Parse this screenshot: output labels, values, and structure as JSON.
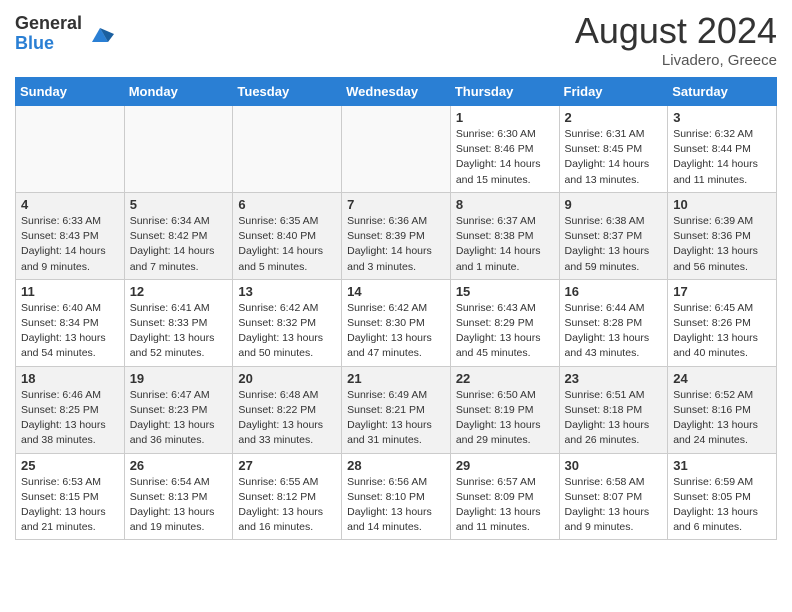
{
  "header": {
    "logo_general": "General",
    "logo_blue": "Blue",
    "month_year": "August 2024",
    "location": "Livadero, Greece"
  },
  "days_of_week": [
    "Sunday",
    "Monday",
    "Tuesday",
    "Wednesday",
    "Thursday",
    "Friday",
    "Saturday"
  ],
  "weeks": [
    [
      {
        "day": "",
        "sunrise": "",
        "sunset": "",
        "daylight": "",
        "empty": true
      },
      {
        "day": "",
        "sunrise": "",
        "sunset": "",
        "daylight": "",
        "empty": true
      },
      {
        "day": "",
        "sunrise": "",
        "sunset": "",
        "daylight": "",
        "empty": true
      },
      {
        "day": "",
        "sunrise": "",
        "sunset": "",
        "daylight": "",
        "empty": true
      },
      {
        "day": "1",
        "sunrise": "Sunrise: 6:30 AM",
        "sunset": "Sunset: 8:46 PM",
        "daylight": "Daylight: 14 hours and 15 minutes."
      },
      {
        "day": "2",
        "sunrise": "Sunrise: 6:31 AM",
        "sunset": "Sunset: 8:45 PM",
        "daylight": "Daylight: 14 hours and 13 minutes."
      },
      {
        "day": "3",
        "sunrise": "Sunrise: 6:32 AM",
        "sunset": "Sunset: 8:44 PM",
        "daylight": "Daylight: 14 hours and 11 minutes."
      }
    ],
    [
      {
        "day": "4",
        "sunrise": "Sunrise: 6:33 AM",
        "sunset": "Sunset: 8:43 PM",
        "daylight": "Daylight: 14 hours and 9 minutes."
      },
      {
        "day": "5",
        "sunrise": "Sunrise: 6:34 AM",
        "sunset": "Sunset: 8:42 PM",
        "daylight": "Daylight: 14 hours and 7 minutes."
      },
      {
        "day": "6",
        "sunrise": "Sunrise: 6:35 AM",
        "sunset": "Sunset: 8:40 PM",
        "daylight": "Daylight: 14 hours and 5 minutes."
      },
      {
        "day": "7",
        "sunrise": "Sunrise: 6:36 AM",
        "sunset": "Sunset: 8:39 PM",
        "daylight": "Daylight: 14 hours and 3 minutes."
      },
      {
        "day": "8",
        "sunrise": "Sunrise: 6:37 AM",
        "sunset": "Sunset: 8:38 PM",
        "daylight": "Daylight: 14 hours and 1 minute."
      },
      {
        "day": "9",
        "sunrise": "Sunrise: 6:38 AM",
        "sunset": "Sunset: 8:37 PM",
        "daylight": "Daylight: 13 hours and 59 minutes."
      },
      {
        "day": "10",
        "sunrise": "Sunrise: 6:39 AM",
        "sunset": "Sunset: 8:36 PM",
        "daylight": "Daylight: 13 hours and 56 minutes."
      }
    ],
    [
      {
        "day": "11",
        "sunrise": "Sunrise: 6:40 AM",
        "sunset": "Sunset: 8:34 PM",
        "daylight": "Daylight: 13 hours and 54 minutes."
      },
      {
        "day": "12",
        "sunrise": "Sunrise: 6:41 AM",
        "sunset": "Sunset: 8:33 PM",
        "daylight": "Daylight: 13 hours and 52 minutes."
      },
      {
        "day": "13",
        "sunrise": "Sunrise: 6:42 AM",
        "sunset": "Sunset: 8:32 PM",
        "daylight": "Daylight: 13 hours and 50 minutes."
      },
      {
        "day": "14",
        "sunrise": "Sunrise: 6:42 AM",
        "sunset": "Sunset: 8:30 PM",
        "daylight": "Daylight: 13 hours and 47 minutes."
      },
      {
        "day": "15",
        "sunrise": "Sunrise: 6:43 AM",
        "sunset": "Sunset: 8:29 PM",
        "daylight": "Daylight: 13 hours and 45 minutes."
      },
      {
        "day": "16",
        "sunrise": "Sunrise: 6:44 AM",
        "sunset": "Sunset: 8:28 PM",
        "daylight": "Daylight: 13 hours and 43 minutes."
      },
      {
        "day": "17",
        "sunrise": "Sunrise: 6:45 AM",
        "sunset": "Sunset: 8:26 PM",
        "daylight": "Daylight: 13 hours and 40 minutes."
      }
    ],
    [
      {
        "day": "18",
        "sunrise": "Sunrise: 6:46 AM",
        "sunset": "Sunset: 8:25 PM",
        "daylight": "Daylight: 13 hours and 38 minutes."
      },
      {
        "day": "19",
        "sunrise": "Sunrise: 6:47 AM",
        "sunset": "Sunset: 8:23 PM",
        "daylight": "Daylight: 13 hours and 36 minutes."
      },
      {
        "day": "20",
        "sunrise": "Sunrise: 6:48 AM",
        "sunset": "Sunset: 8:22 PM",
        "daylight": "Daylight: 13 hours and 33 minutes."
      },
      {
        "day": "21",
        "sunrise": "Sunrise: 6:49 AM",
        "sunset": "Sunset: 8:21 PM",
        "daylight": "Daylight: 13 hours and 31 minutes."
      },
      {
        "day": "22",
        "sunrise": "Sunrise: 6:50 AM",
        "sunset": "Sunset: 8:19 PM",
        "daylight": "Daylight: 13 hours and 29 minutes."
      },
      {
        "day": "23",
        "sunrise": "Sunrise: 6:51 AM",
        "sunset": "Sunset: 8:18 PM",
        "daylight": "Daylight: 13 hours and 26 minutes."
      },
      {
        "day": "24",
        "sunrise": "Sunrise: 6:52 AM",
        "sunset": "Sunset: 8:16 PM",
        "daylight": "Daylight: 13 hours and 24 minutes."
      }
    ],
    [
      {
        "day": "25",
        "sunrise": "Sunrise: 6:53 AM",
        "sunset": "Sunset: 8:15 PM",
        "daylight": "Daylight: 13 hours and 21 minutes."
      },
      {
        "day": "26",
        "sunrise": "Sunrise: 6:54 AM",
        "sunset": "Sunset: 8:13 PM",
        "daylight": "Daylight: 13 hours and 19 minutes."
      },
      {
        "day": "27",
        "sunrise": "Sunrise: 6:55 AM",
        "sunset": "Sunset: 8:12 PM",
        "daylight": "Daylight: 13 hours and 16 minutes."
      },
      {
        "day": "28",
        "sunrise": "Sunrise: 6:56 AM",
        "sunset": "Sunset: 8:10 PM",
        "daylight": "Daylight: 13 hours and 14 minutes."
      },
      {
        "day": "29",
        "sunrise": "Sunrise: 6:57 AM",
        "sunset": "Sunset: 8:09 PM",
        "daylight": "Daylight: 13 hours and 11 minutes."
      },
      {
        "day": "30",
        "sunrise": "Sunrise: 6:58 AM",
        "sunset": "Sunset: 8:07 PM",
        "daylight": "Daylight: 13 hours and 9 minutes."
      },
      {
        "day": "31",
        "sunrise": "Sunrise: 6:59 AM",
        "sunset": "Sunset: 8:05 PM",
        "daylight": "Daylight: 13 hours and 6 minutes."
      }
    ]
  ]
}
